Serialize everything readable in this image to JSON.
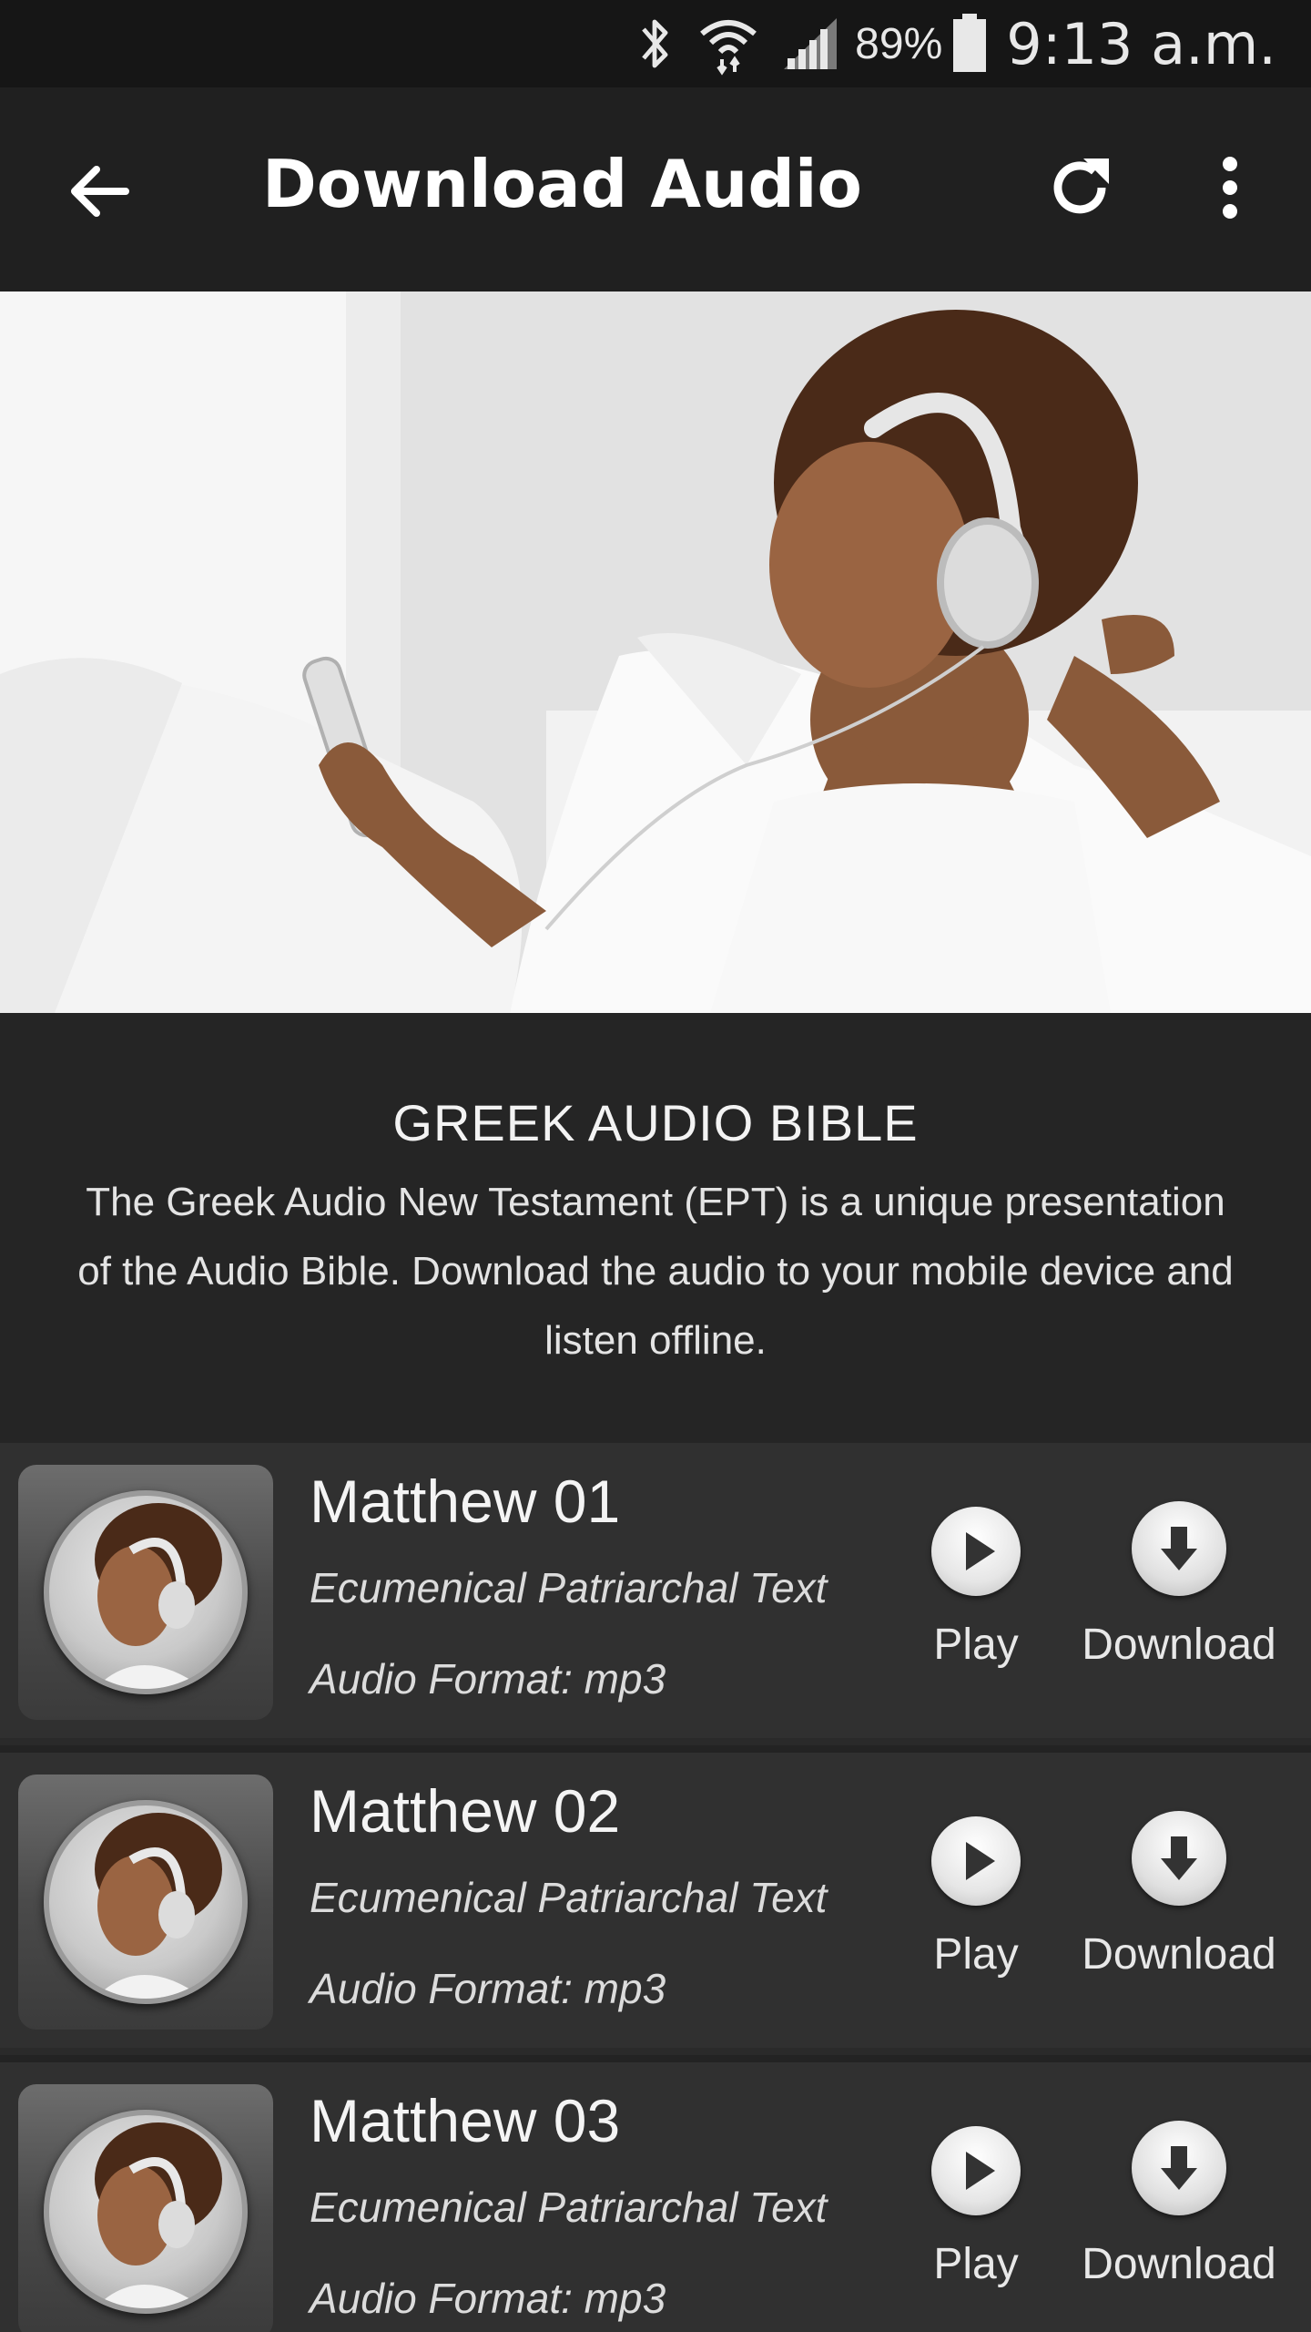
{
  "status_bar": {
    "battery_percent": "89%",
    "time": "9:13 a.m.",
    "icons": [
      "bluetooth-icon",
      "wifi-icon",
      "signal-icon",
      "battery-icon"
    ]
  },
  "app_bar": {
    "title": "Download Audio",
    "icons": [
      "back-arrow-icon",
      "refresh-icon",
      "more-vert-icon"
    ]
  },
  "info": {
    "heading": "GREEK AUDIO BIBLE",
    "description": "The Greek Audio New Testament (EPT) is a unique presentation of the Audio Bible. Download the audio to your mobile device and listen offline."
  },
  "tracks": [
    {
      "title": "Matthew 01",
      "subtitle": "Ecumenical Patriarchal Text",
      "format": "Audio Format: mp3",
      "play_label": "Play",
      "download_label": "Download"
    },
    {
      "title": "Matthew 02",
      "subtitle": "Ecumenical Patriarchal Text",
      "format": "Audio Format: mp3",
      "play_label": "Play",
      "download_label": "Download"
    },
    {
      "title": "Matthew 03",
      "subtitle": "Ecumenical Patriarchal Text",
      "format": "Audio Format: mp3",
      "play_label": "Play",
      "download_label": "Download"
    }
  ],
  "colors": {
    "status_bar_bg": "#161616",
    "app_bar_bg": "#202020",
    "description_bg": "#252525",
    "row_bg": "#303030"
  }
}
